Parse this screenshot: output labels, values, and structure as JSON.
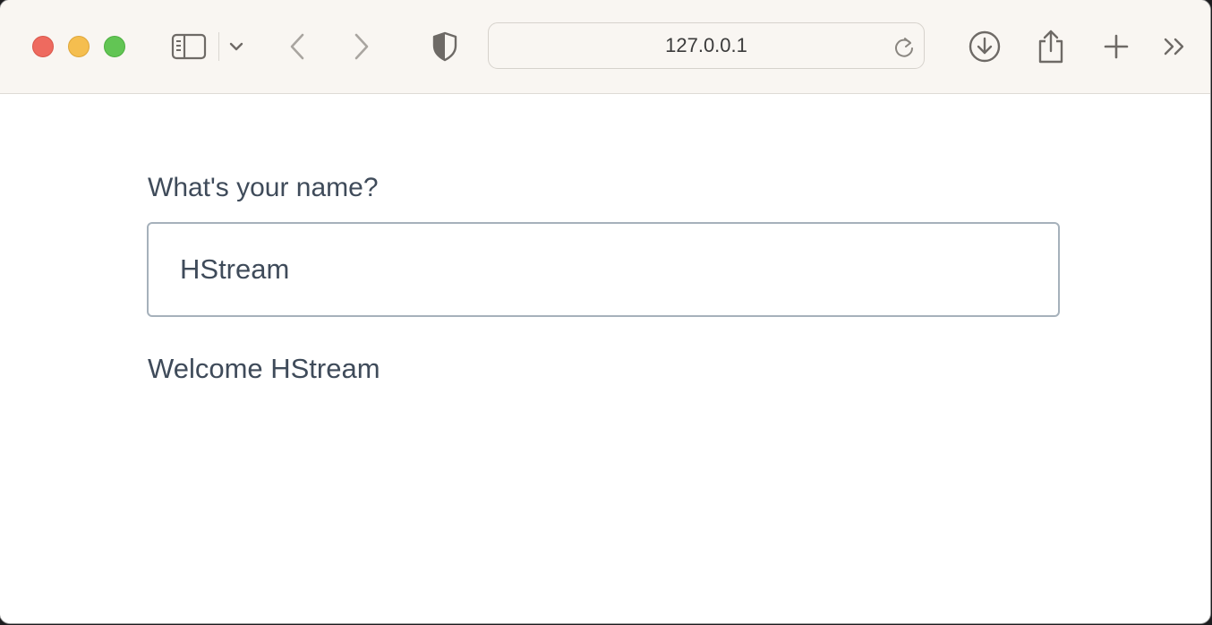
{
  "browser": {
    "address_text": "127.0.0.1",
    "icons": {
      "sidebar": "sidebar-icon",
      "chevron": "chevron-down-icon",
      "back": "back-arrow-icon",
      "forward": "forward-arrow-icon",
      "shield": "privacy-shield-icon",
      "reload": "reload-icon",
      "download": "download-icon",
      "share": "share-icon",
      "new_tab": "plus-icon",
      "more": "more-chevrons-icon"
    },
    "colors": {
      "close": "#ee6a5f",
      "minimize": "#f5be4f",
      "maximize": "#62c554",
      "toolbar_bg": "#f9f6f2"
    }
  },
  "page": {
    "prompt_label": "What's your name?",
    "name_value": "HStream",
    "welcome_text": "Welcome HStream",
    "text_color": "#3f4b5a"
  }
}
